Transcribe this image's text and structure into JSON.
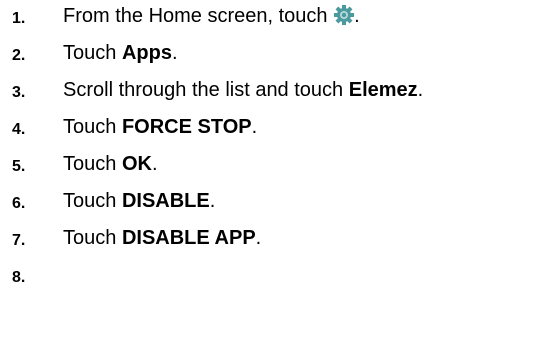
{
  "steps": [
    {
      "number": "1.",
      "prefix": "From the Home screen, touch ",
      "bold": "",
      "suffix": ".",
      "icon": "settings-gear-icon"
    },
    {
      "number": "2.",
      "prefix": "Touch ",
      "bold": "Apps",
      "suffix": "."
    },
    {
      "number": "3.",
      "prefix": "Scroll through the list and touch ",
      "bold": "Elemez",
      "suffix": "."
    },
    {
      "number": "4.",
      "prefix": "Touch ",
      "bold": "FORCE STOP",
      "suffix": "."
    },
    {
      "number": "5.",
      "prefix": "Touch ",
      "bold": "OK",
      "suffix": "."
    },
    {
      "number": "6.",
      "prefix": "Touch ",
      "bold": "DISABLE",
      "suffix": "."
    },
    {
      "number": "7.",
      "prefix": "Touch ",
      "bold": "DISABLE APP",
      "suffix": "."
    },
    {
      "number": "8.",
      "prefix": "",
      "bold": "",
      "suffix": ""
    }
  ],
  "colors": {
    "text": "#000000",
    "gear_icon": "#4a9aa0",
    "gear_icon_inner": "#b8d7db",
    "background": "#ffffff"
  }
}
